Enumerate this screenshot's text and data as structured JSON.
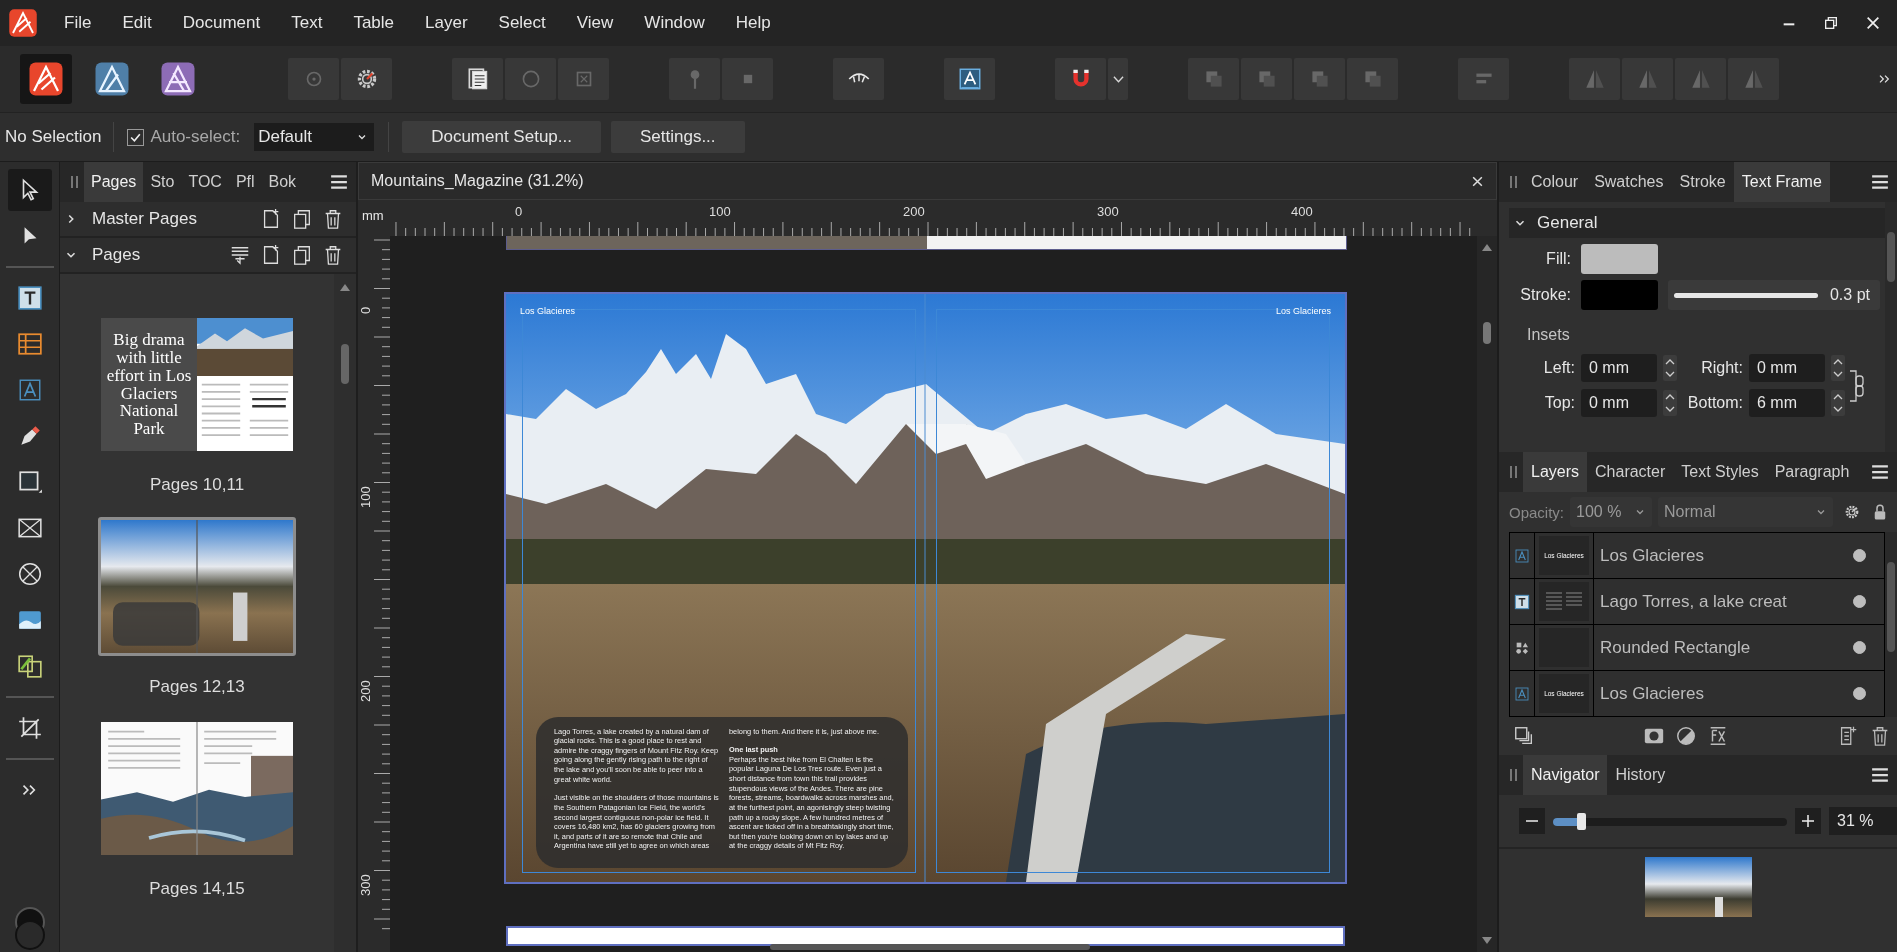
{
  "menu_bar": {
    "items": [
      "File",
      "Edit",
      "Document",
      "Text",
      "Table",
      "Layer",
      "Select",
      "View",
      "Window",
      "Help"
    ]
  },
  "personas": [
    {
      "kind": "publisher",
      "selected": true
    },
    {
      "kind": "designer",
      "selected": false
    },
    {
      "kind": "photo",
      "selected": false
    }
  ],
  "toolbar": {
    "groups": [
      [
        {
          "kind": "circle-dot",
          "disabled": true
        },
        {
          "kind": "gear",
          "disabled": false
        }
      ],
      [
        {
          "kind": "pages",
          "disabled": false
        },
        {
          "kind": "circle",
          "disabled": true
        },
        {
          "kind": "square-x",
          "disabled": true
        }
      ],
      [
        {
          "kind": "pin",
          "disabled": true
        },
        {
          "kind": "small-square",
          "disabled": true
        }
      ],
      [
        {
          "kind": "view",
          "disabled": false
        }
      ],
      [
        {
          "kind": "text-frame",
          "disabled": false
        }
      ],
      [
        {
          "kind": "magnet",
          "disabled": false
        },
        {
          "kind": "dropdown",
          "disabled": false
        }
      ],
      [
        {
          "kind": "arrange",
          "disabled": true
        },
        {
          "kind": "arrange",
          "disabled": true
        },
        {
          "kind": "arrange",
          "disabled": true
        },
        {
          "kind": "arrange",
          "disabled": true
        }
      ],
      [
        {
          "kind": "align",
          "disabled": true
        }
      ],
      [
        {
          "kind": "flip",
          "disabled": true
        },
        {
          "kind": "flip",
          "disabled": true
        },
        {
          "kind": "flip",
          "disabled": true
        },
        {
          "kind": "flip",
          "disabled": true
        }
      ]
    ]
  },
  "context_bar": {
    "selection": "No Selection",
    "auto_select": {
      "label": "Auto-select:",
      "checked": true
    },
    "mode": "Default",
    "buttons": [
      "Document Setup...",
      "Settings..."
    ]
  },
  "tools": [
    [
      {
        "kind": "move",
        "selected": true
      },
      {
        "kind": "node",
        "selected": false
      }
    ],
    [
      {
        "kind": "frame-text",
        "selected": false
      },
      {
        "kind": "table",
        "selected": false
      },
      {
        "kind": "artistic-text",
        "selected": false
      },
      {
        "kind": "pen",
        "selected": false
      },
      {
        "kind": "rectangle",
        "selected": false
      },
      {
        "kind": "picture-frame",
        "selected": false
      },
      {
        "kind": "ellipse-frame",
        "selected": false
      },
      {
        "kind": "image",
        "selected": false
      },
      {
        "kind": "linked-frames",
        "selected": false
      }
    ],
    [
      {
        "kind": "crop",
        "selected": false
      }
    ],
    [
      {
        "kind": "more",
        "selected": false
      }
    ]
  ],
  "pages_panel": {
    "tabs": [
      {
        "label": "Pages",
        "selected": true
      },
      {
        "label": "Sto",
        "selected": false
      },
      {
        "label": "TOC",
        "selected": false
      },
      {
        "label": "Pfl",
        "selected": false
      },
      {
        "label": "Bok",
        "selected": false
      }
    ],
    "sections": [
      {
        "label": "Master Pages",
        "expanded": false
      },
      {
        "label": "Pages",
        "expanded": true
      }
    ],
    "thumbnails": [
      {
        "kind": "title-spread",
        "title": "Big drama with little effort in Los Glaciers National Park",
        "caption": "Pages 10,11",
        "selected": false
      },
      {
        "kind": "photo-spread",
        "caption": "Pages 12,13",
        "selected": true
      },
      {
        "kind": "river-spread",
        "caption": "Pages 14,15",
        "selected": false
      }
    ]
  },
  "document": {
    "tab": "Mountains_Magazine (31.2%)",
    "ruler_unit": "mm",
    "horizontal_ruler": [
      "0",
      "100",
      "200",
      "300",
      "400"
    ],
    "vertical_ruler": [
      "0",
      "100",
      "200",
      "300"
    ],
    "spread": {
      "headers": [
        "Los Glacieres",
        "Los Glacieres"
      ],
      "text_frame": {
        "columns": [
          [
            {
              "kind": "body",
              "text": "Lago Torres, a lake created by a natural dam of glacial rocks. This is a good place to rest and admire the craggy fingers of Mount Fitz Roy. Keep going along the gently rising path to the right of the lake and you'll soon be able to peer into a great white world."
            },
            {
              "kind": "body",
              "text": "Just visible on the shoulders of those mountains is the Southern Patagonian Ice Field, the world's second largest contiguous non-polar ice field. It covers 16,480 km2, has 60 glaciers growing from it, and parts of it are so remote that Chile and Argentina have still yet to agree on which areas"
            }
          ],
          [
            {
              "kind": "body",
              "text": "belong to them. And there it is, just above me."
            },
            {
              "kind": "heading",
              "text": "One last push"
            },
            {
              "kind": "body",
              "text": "Perhaps the best hike from El Chalten is the popular Laguna De Los Tres route. Even just a short distance from town this trail provides stupendous views of the Andes. There are pine forests, streams, boardwalks across marshes and, at the furthest point, an agonisingly steep twisting path up a rocky slope.  A few hundred metres of ascent are ticked off in a breathtakingly short time, but then you're looking down on icy lakes and up at the craggy details of Mt Fitz Roy."
            }
          ]
        ]
      }
    }
  },
  "text_frame_panel": {
    "tabs": [
      {
        "label": "Colour",
        "selected": false
      },
      {
        "label": "Swatches",
        "selected": false
      },
      {
        "label": "Stroke",
        "selected": false
      },
      {
        "label": "Text Frame",
        "selected": true
      }
    ],
    "section": {
      "label": "General",
      "expanded": true
    },
    "fill": {
      "label": "Fill:",
      "color": "#bcbcbc"
    },
    "stroke": {
      "label": "Stroke:",
      "color": "#000000",
      "level": 1,
      "reading": "0.3 pt"
    },
    "insets_label": "Insets",
    "insets": [
      {
        "label": "Left:",
        "value": "0 mm"
      },
      {
        "label": "Right:",
        "value": "0 mm"
      },
      {
        "label": "Top:",
        "value": "0 mm"
      },
      {
        "label": "Bottom:",
        "value": "6 mm"
      }
    ]
  },
  "layers_panel": {
    "tabs": [
      {
        "label": "Layers",
        "selected": true
      },
      {
        "label": "Character",
        "selected": false
      },
      {
        "label": "Text Styles",
        "selected": false
      },
      {
        "label": "Paragraph",
        "selected": false
      }
    ],
    "opacity_label": "Opacity:",
    "opacity": "100 %",
    "blend_mode": "Normal",
    "layers": [
      {
        "kind": "artistic-text",
        "thumbnail_text": "Los Glacieres",
        "name": "Los Glacieres",
        "visible": true
      },
      {
        "kind": "frame-text",
        "name": "Lago Torres, a lake creat",
        "visible": true
      },
      {
        "kind": "shape",
        "name": "Rounded Rectangle",
        "visible": true
      },
      {
        "kind": "artistic-text",
        "thumbnail_text": "Los Glacieres",
        "name": "Los Glacieres",
        "visible": true
      }
    ]
  },
  "navigator_panel": {
    "tabs": [
      {
        "label": "Navigator",
        "selected": true
      },
      {
        "label": "History",
        "selected": false
      }
    ],
    "level": 0.12,
    "zoom": "31 %"
  }
}
